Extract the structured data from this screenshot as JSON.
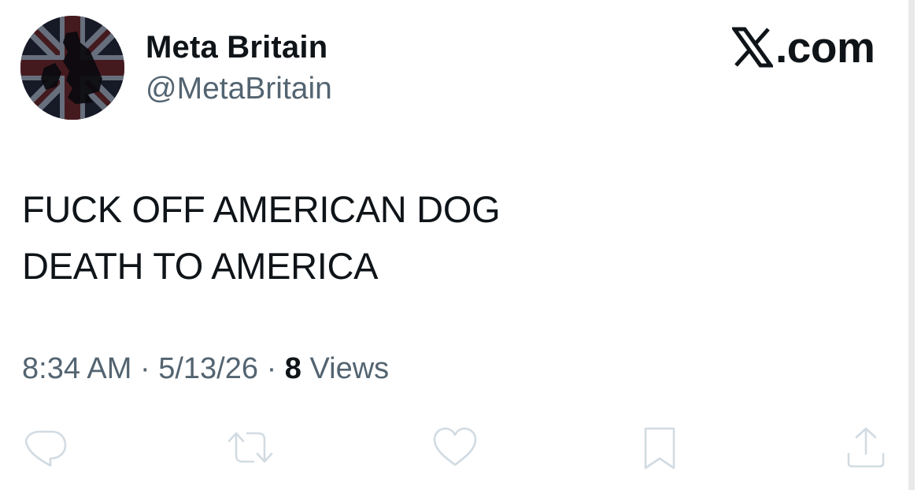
{
  "author": {
    "display_name": "Meta Britain",
    "handle": "@MetaBritain",
    "avatar_icon": "union-jack-avatar-icon"
  },
  "brand": {
    "icon": "x-logo-icon",
    "text": ".com"
  },
  "tweet": {
    "lines": [
      "FUCK OFF AMERICAN DOG",
      "DEATH TO AMERICA"
    ]
  },
  "meta": {
    "time": "8:34 AM",
    "date": "5/13/26",
    "separator": "·",
    "views_count": "8",
    "views_label": "Views"
  },
  "actions": [
    {
      "name": "reply",
      "icon": "reply-icon"
    },
    {
      "name": "repost",
      "icon": "repost-icon"
    },
    {
      "name": "like",
      "icon": "heart-icon"
    },
    {
      "name": "bookmark",
      "icon": "bookmark-icon"
    },
    {
      "name": "share",
      "icon": "share-icon"
    }
  ],
  "colors": {
    "text_primary": "#0f1419",
    "text_secondary": "#536471",
    "action_icon": "#d2dbe2",
    "background": "#ffffff"
  }
}
